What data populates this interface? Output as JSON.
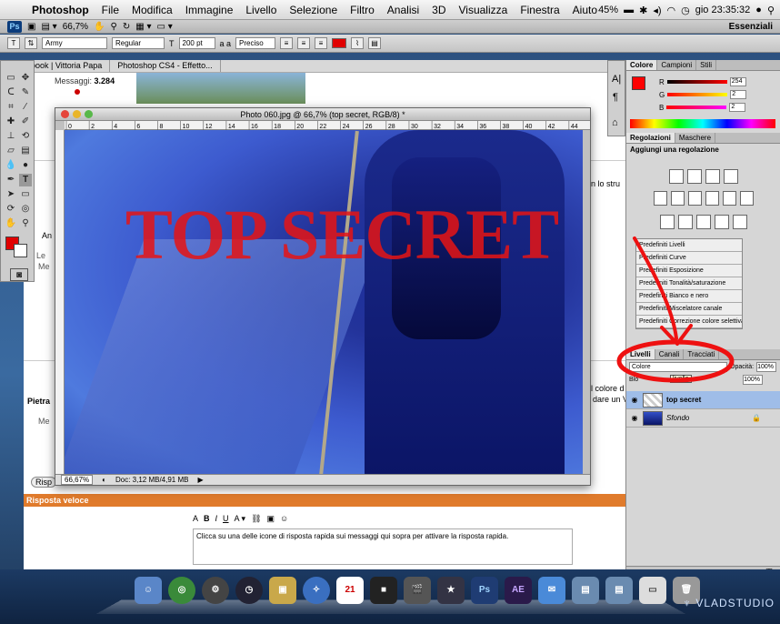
{
  "menubar": {
    "app": "Photoshop",
    "items": [
      "File",
      "Modifica",
      "Immagine",
      "Livello",
      "Selezione",
      "Filtro",
      "Analisi",
      "3D",
      "Visualizza",
      "Finestra",
      "Aiuto"
    ],
    "battery": "45%",
    "clock": "gio 23:35:32"
  },
  "appbar": {
    "zoom": "66,7%",
    "workspace": "Essenziali"
  },
  "options": {
    "font_family": "Army",
    "font_style": "Regular",
    "font_size": "200 pt",
    "aa_label": "a a",
    "antialias": "Preciso",
    "text_color": "#e00000"
  },
  "browser": {
    "tab1": "book | Vittoria Papa",
    "tab2": "Photoshop CS4 - Effetto...",
    "messages_label": "Messaggi:",
    "messages_count": "3.284",
    "side_labels": [
      "An",
      "Le",
      "Me",
      "Pietra",
      "Me"
    ],
    "right_text1": "n lo stru",
    "right_text2": "l colore d",
    "right_text3": "dare un V",
    "reply_button": "Risp",
    "quick_reply": "Risposta veloce",
    "editor_placeholder": "Clicca su una delle icone di risposta rapida sui messaggi qui sopra per attivare la risposta rapida."
  },
  "document": {
    "title": "Photo 060.jpg @ 66,7% (top secret, RGB/8) *",
    "overlay_text": "TOP SECRET",
    "ruler_marks": [
      "0",
      "2",
      "4",
      "6",
      "8",
      "10",
      "12",
      "14",
      "16",
      "18",
      "20",
      "22",
      "24",
      "26",
      "28",
      "30",
      "32",
      "34",
      "36",
      "38",
      "40",
      "42",
      "44"
    ],
    "zoom": "66,67%",
    "doc_info": "Doc: 3,12 MB/4,91 MB"
  },
  "color_panel": {
    "tabs": [
      "Colore",
      "Campioni",
      "Stili"
    ],
    "r_label": "R",
    "r_value": "254",
    "g_label": "G",
    "g_value": "2",
    "b_label": "B",
    "b_value": "2",
    "foreground": "#fe0202"
  },
  "adjustments": {
    "tabs": [
      "Regolazioni",
      "Maschere"
    ],
    "heading": "Aggiungi una regolazione",
    "presets": [
      "Predefiniti Livelli",
      "Predefiniti Curve",
      "Predefiniti Esposizione",
      "Predefiniti Tonalità/saturazione",
      "Predefiniti Bianco e nero",
      "Predefiniti Miscelatore canale",
      "Predefiniti Correzione colore selettiva"
    ]
  },
  "layers": {
    "tabs": [
      "Livelli",
      "Canali",
      "Tracciati"
    ],
    "blend_mode": "Colore",
    "opacity_label": "Opacità:",
    "opacity": "100%",
    "fill": "100%",
    "lock_label": "Blo",
    "tooltip": "livello",
    "items": [
      {
        "name": "top secret"
      },
      {
        "name": "Sfondo"
      }
    ]
  },
  "dock": {
    "brand": "VLADSTUDIO",
    "calendar_day": "21",
    "ps_label": "Ps",
    "ae_label": "AE"
  },
  "colors": {
    "annotation": "#ee1111",
    "quick_reply_bar": "#e07b2c"
  }
}
